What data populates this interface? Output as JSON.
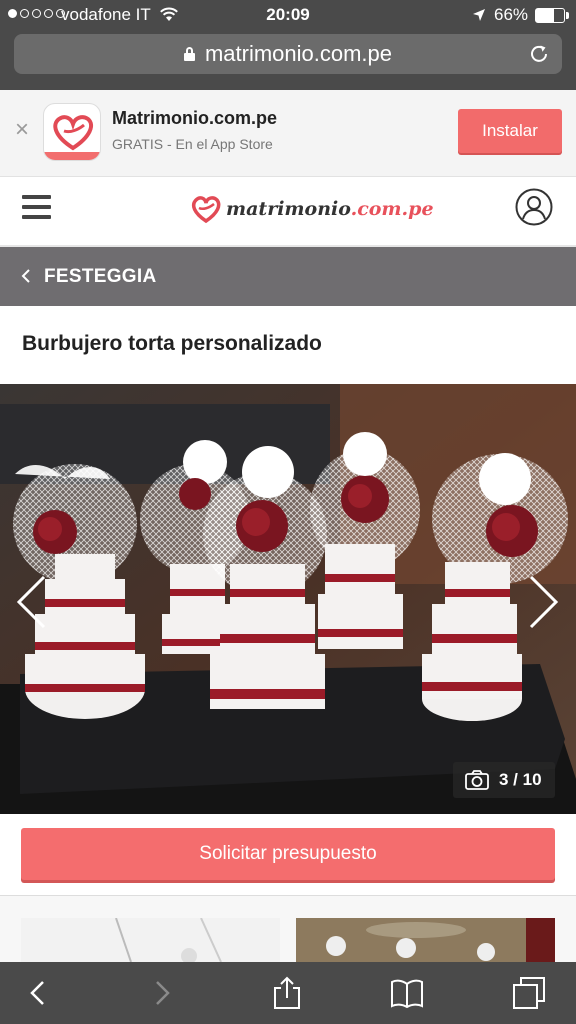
{
  "status_bar": {
    "carrier": "vodafone IT",
    "time": "20:09",
    "battery": "66%",
    "battery_level": 0.66,
    "signal_bars_filled": 1,
    "signal_bars_total": 5
  },
  "browser": {
    "url": "matrimonio.com.pe"
  },
  "app_banner": {
    "app_name": "Matrimonio.com.pe",
    "subtitle": "GRATIS - En el App Store",
    "install_label": "Instalar"
  },
  "header": {
    "logo_part1": "matrimonio",
    "logo_part2": ".com.pe"
  },
  "section": {
    "label": "FESTEGGIA"
  },
  "page": {
    "title": "Burbujero torta personalizado"
  },
  "gallery": {
    "current": 3,
    "total": 10,
    "counter": "3 / 10"
  },
  "cta": {
    "label": "Solicitar presupuesto"
  },
  "colors": {
    "brand": "#f26b6b",
    "header_bar": "#6f6d70",
    "chrome": "#4a4a4a"
  },
  "icons": [
    "lock-icon",
    "reload-icon",
    "close-icon",
    "hamburger-menu-icon",
    "user-icon",
    "chevron-left-icon",
    "arrow-left-icon",
    "arrow-right-icon",
    "camera-icon",
    "back-icon",
    "forward-icon",
    "share-icon",
    "bookmarks-icon",
    "tabs-icon"
  ]
}
